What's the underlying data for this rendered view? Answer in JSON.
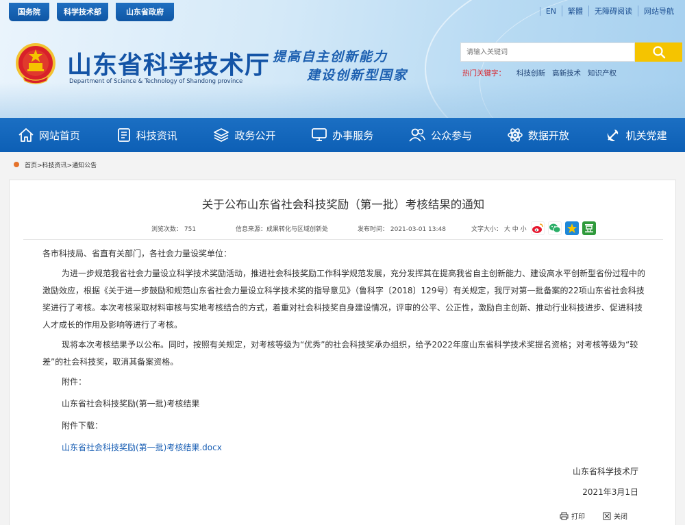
{
  "header": {
    "top_tabs": [
      "国务院",
      "科学技术部",
      "山东省政府"
    ],
    "top_links": [
      "EN",
      "繁體",
      "无障碍阅读",
      "网站导航"
    ],
    "site_title": "山东省科学技术厅",
    "site_subtitle": "Department of Science & Technology of Shandong province",
    "slogan_line1": "提高自主创新能力",
    "slogan_line2": "建设创新型国家",
    "search_placeholder": "请输入关键词",
    "hot_label": "热门关键字：",
    "hot_keywords": [
      "科技创新",
      "高新技术",
      "知识产权"
    ]
  },
  "nav": {
    "items": [
      "网站首页",
      "科技资讯",
      "政务公开",
      "办事服务",
      "公众参与",
      "数据开放",
      "机关党建"
    ]
  },
  "breadcrumb": "首页>科技资讯>通知公告",
  "article": {
    "title": "关于公布山东省社会科技奖励（第一批）考核结果的通知",
    "views": "浏览次数：  751",
    "source": "信息来源：成果转化与区域创新处",
    "date": "发布时间：  2021-03-01 13:48",
    "font_size": "文字大小：  大 中 小",
    "greeting": "各市科技局、省直有关部门，各社会力量设奖单位：",
    "para1": "为进一步规范我省社会力量设立科学技术奖励活动，推进社会科技奖励工作科学规范发展，充分发挥其在提高我省自主创新能力、建设高水平创新型省份过程中的激励效应，根据《关于进一步鼓励和规范山东省社会力量设立科学技术奖的指导意见》（鲁科字〔2018〕129号）有关规定，我厅对第一批备案的22项山东省社会科技奖进行了考核。本次考核采取材料审核与实地考核结合的方式，着重对社会科技奖自身建设情况，评审的公平、公正性，激励自主创新、推动行业科技进步、促进科技人才成长的作用及影响等进行了考核。",
    "para2": "现将本次考核结果予以公布。同时，按照有关规定，对考核等级为“优秀”的社会科技奖承办组织，给予2022年度山东省科学技术奖提名资格；对考核等级为“较差”的社会科技奖，取消其备案资格。",
    "attachment_label": "附件：",
    "attachment_name": "山东省社会科技奖励(第一批)考核结果",
    "download_label": "附件下载：",
    "download_link": "山东省社会科技奖励(第一批)考核结果.docx",
    "signature": "山东省科学技术厅",
    "sign_date": "2021年3月1日"
  },
  "actions": {
    "print": "打印",
    "close": "关闭"
  },
  "colors": {
    "brand_blue": "#1454a6",
    "nav_blue": "#0d5fb5",
    "search_yellow": "#f5c400",
    "hot_red": "#d9222a",
    "link_blue": "#1a5fb4"
  }
}
